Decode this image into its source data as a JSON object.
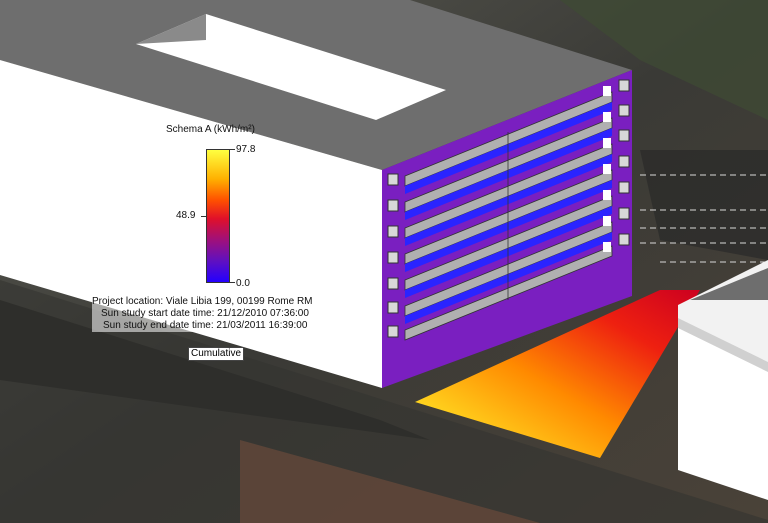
{
  "legend": {
    "title": "Schema A (kWh/m²)",
    "max_label": "97.8",
    "mid_label": "48.9",
    "min_label": "0.0"
  },
  "study_info": {
    "location": "Project location: Viale Libia 199, 00199 Rome RM",
    "start": "Sun study start date time: 21/12/2010 07:36:00",
    "end": "Sun study end date time: 21/03/2011 16:39:00"
  },
  "mode_button": "Cumulative",
  "colors": {
    "facade": "#7a1fc0",
    "roof": "#6e6e6e",
    "wall": "#ffffff",
    "accent_low": "#2400ff",
    "accent_high": "#ffff40"
  }
}
